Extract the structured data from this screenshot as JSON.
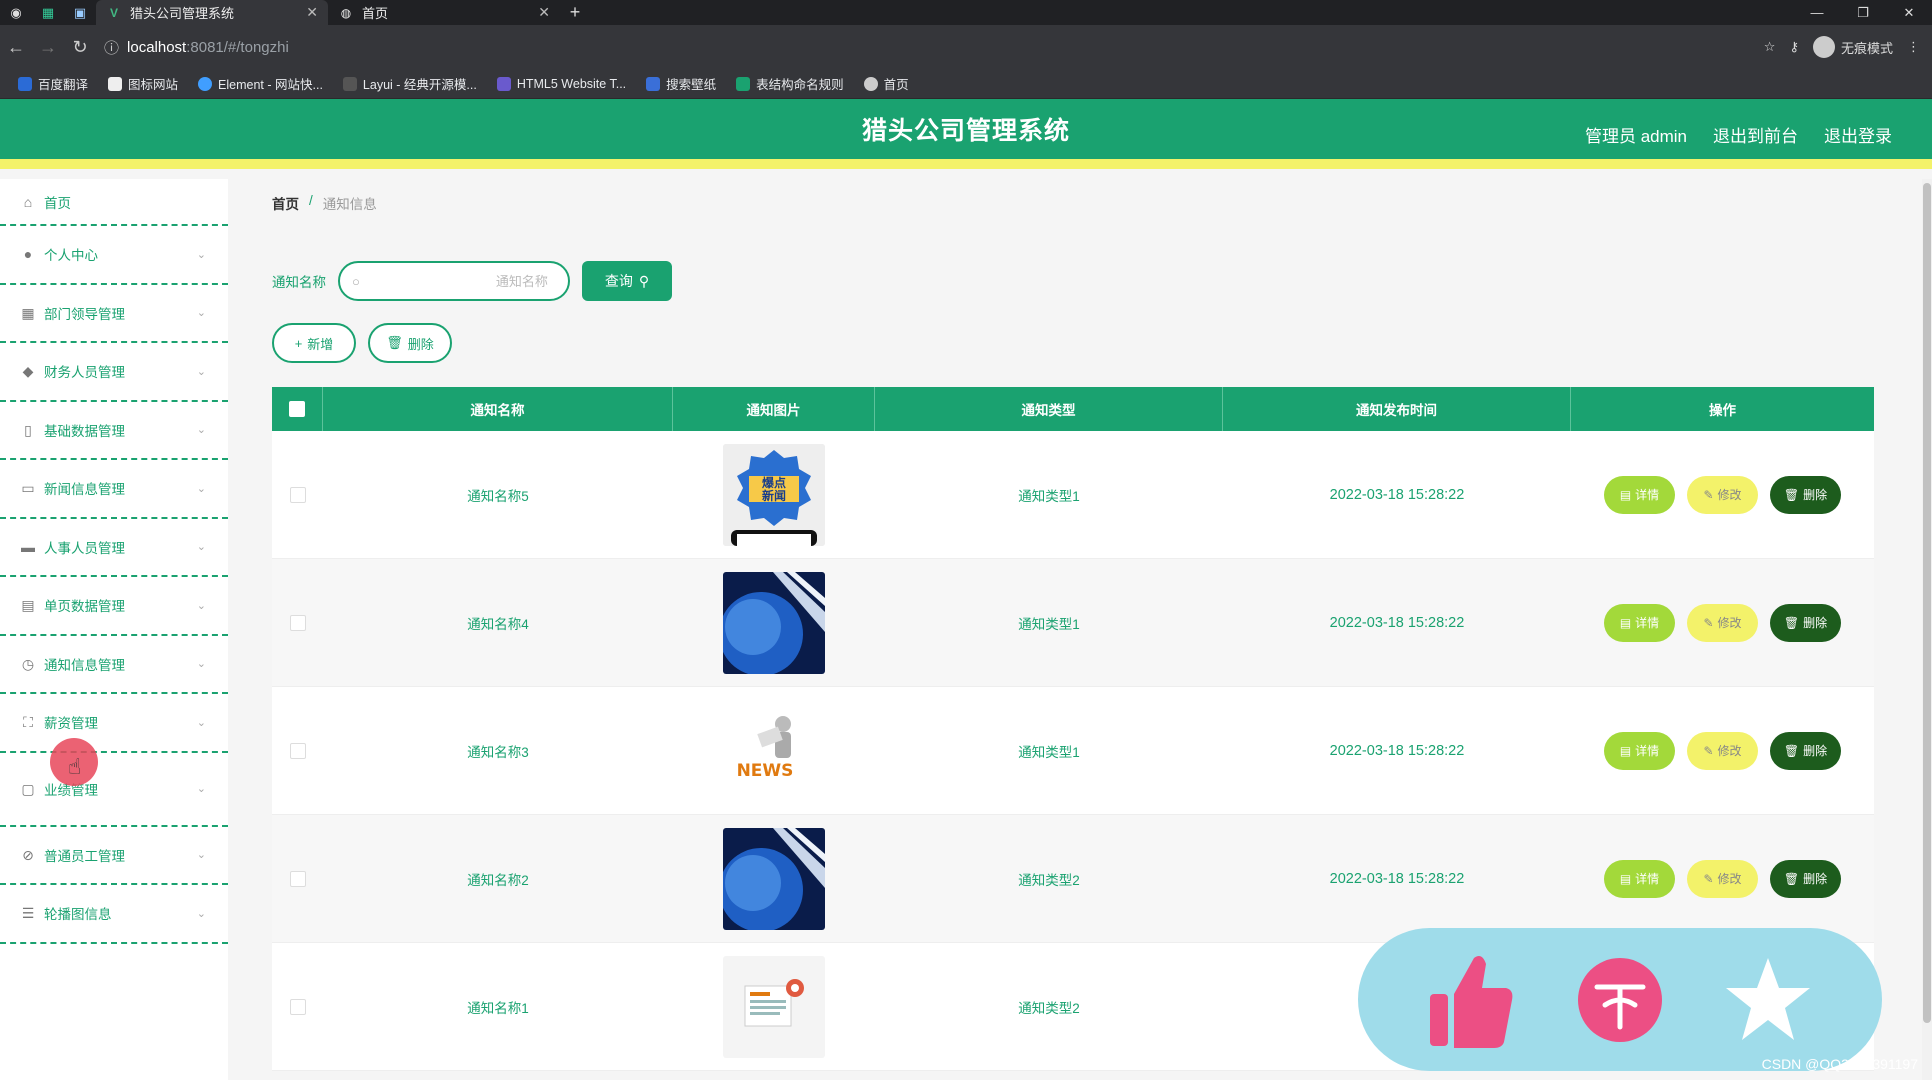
{
  "browser": {
    "tabs": [
      {
        "title": "猎头公司管理系统",
        "active": true
      },
      {
        "title": "首页",
        "active": false
      }
    ],
    "url_host": "localhost",
    "url_path": ":8081/#/tongzhi",
    "incognito_label": "无痕模式",
    "bookmarks": [
      "百度翻译",
      "图标网站",
      "Element - 网站快...",
      "Layui - 经典开源模...",
      "HTML5 Website T...",
      "搜索壁纸",
      "表结构命名规则",
      "首页"
    ]
  },
  "header": {
    "title": "猎头公司管理系统",
    "admin": "管理员 admin",
    "to_front": "退出到前台",
    "logout": "退出登录"
  },
  "sidebar": {
    "items": [
      {
        "label": "首页",
        "icon": "home-icon"
      },
      {
        "label": "个人中心",
        "icon": "user-icon"
      },
      {
        "label": "部门领导管理",
        "icon": "grid-icon"
      },
      {
        "label": "财务人员管理",
        "icon": "location-icon"
      },
      {
        "label": "基础数据管理",
        "icon": "phone-icon"
      },
      {
        "label": "新闻信息管理",
        "icon": "news-icon"
      },
      {
        "label": "人事人员管理",
        "icon": "monitor-icon"
      },
      {
        "label": "单页数据管理",
        "icon": "table-icon"
      },
      {
        "label": "通知信息管理",
        "icon": "clock-icon"
      },
      {
        "label": "薪资管理",
        "icon": "frame-icon"
      },
      {
        "label": "业绩管理",
        "icon": "chat-icon"
      },
      {
        "label": "普通员工管理",
        "icon": "no-icon"
      },
      {
        "label": "轮播图信息",
        "icon": "menu-icon"
      }
    ]
  },
  "breadcrumb": {
    "home": "首页",
    "sep": "/",
    "current": "通知信息"
  },
  "search": {
    "label": "通知名称",
    "placeholder": "通知名称",
    "query_btn": "查询"
  },
  "actions": {
    "add": "新增",
    "delete": "删除"
  },
  "table": {
    "headers": [
      "通知名称",
      "通知图片",
      "通知类型",
      "通知发布时间",
      "操作"
    ],
    "rows": [
      {
        "name": "通知名称5",
        "img": "baodian-news",
        "type": "通知类型1",
        "time": "2022-03-18 15:28:22"
      },
      {
        "name": "通知名称4",
        "img": "globe",
        "type": "通知类型1",
        "time": "2022-03-18 15:28:22"
      },
      {
        "name": "通知名称3",
        "img": "news-figure",
        "type": "通知类型1",
        "time": "2022-03-18 15:28:22"
      },
      {
        "name": "通知名称2",
        "img": "globe",
        "type": "通知类型2",
        "time": "2022-03-18 15:28:22"
      },
      {
        "name": "通知名称1",
        "img": "newspaper",
        "type": "通知类型2",
        "time": "202"
      }
    ],
    "op_labels": {
      "detail": "详情",
      "edit": "修改",
      "del": "删除"
    }
  },
  "thumb_text": {
    "baodian_1": "爆点",
    "baodian_2": "新闻",
    "news": "NEWS"
  },
  "watermark": "CSDN @QQ3295391197",
  "colors": {
    "primary": "#1aa270",
    "accent_yellow": "#f3f26a",
    "detail": "#a3d93a",
    "danger": "#1d5c1d"
  }
}
